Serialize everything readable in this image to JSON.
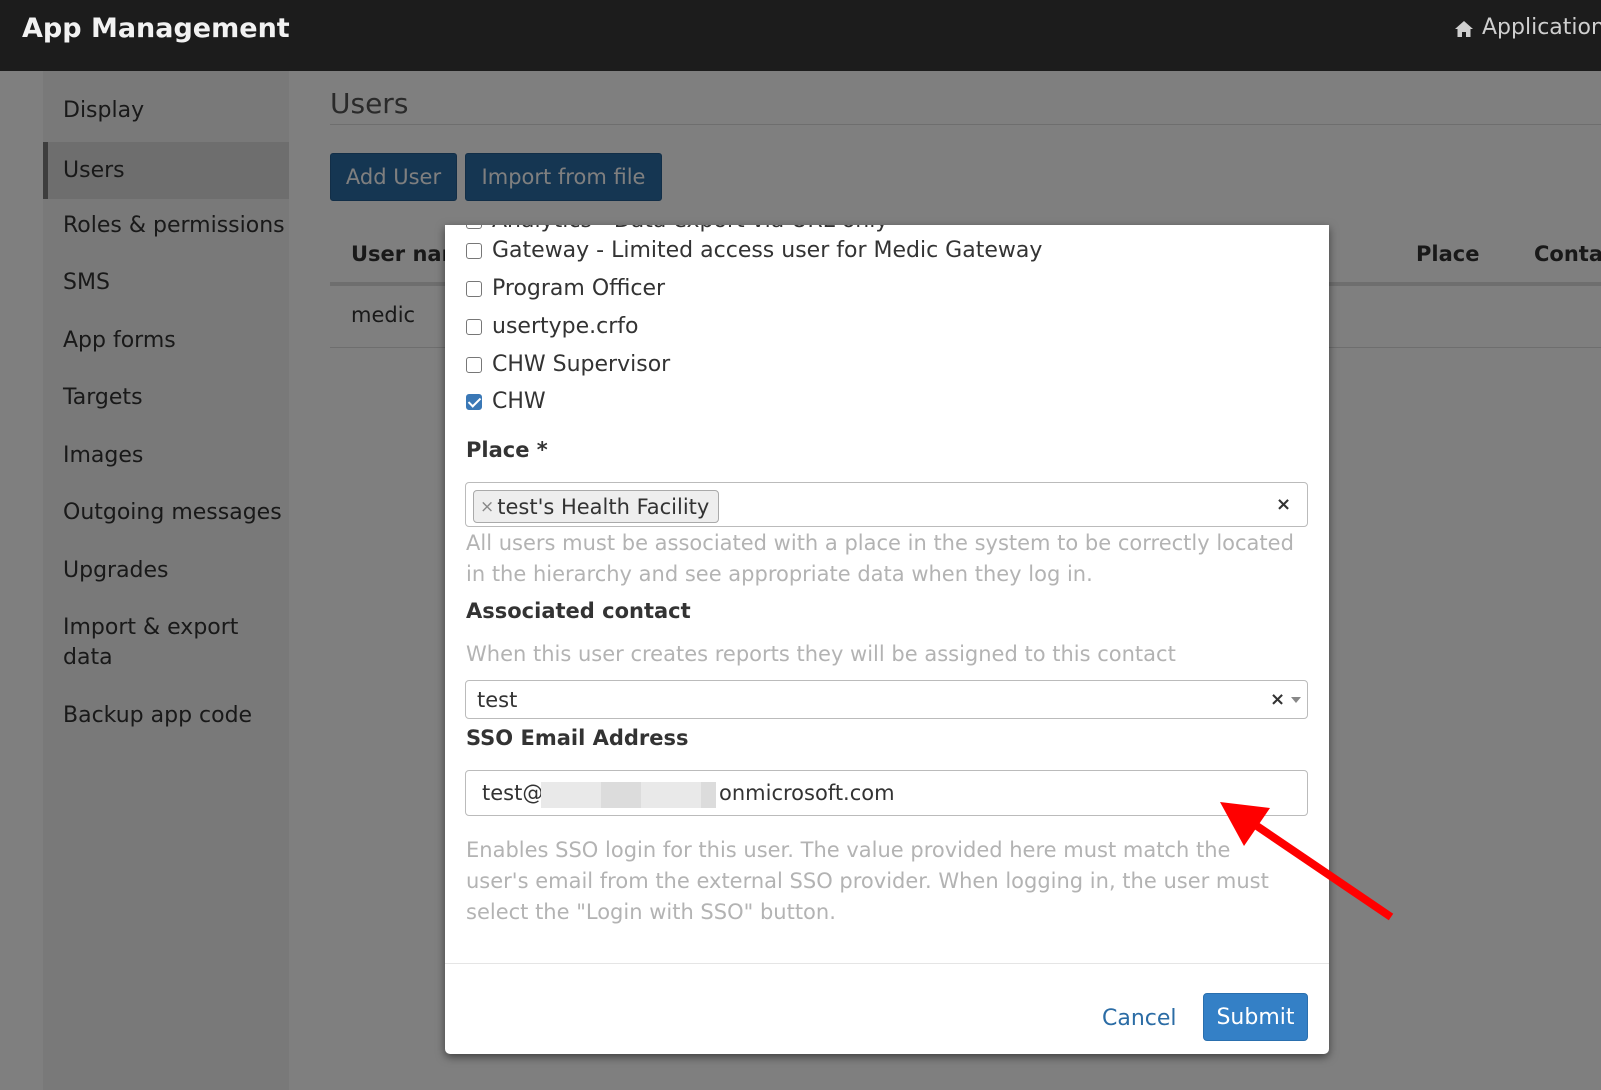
{
  "header": {
    "title": "App Management",
    "application_link": "Application",
    "home_icon": "home-icon"
  },
  "sidebar": {
    "items": [
      {
        "label": "Display"
      },
      {
        "label": "Users",
        "active": true
      },
      {
        "label": "Roles & permissions"
      },
      {
        "label": "SMS"
      },
      {
        "label": "App forms"
      },
      {
        "label": "Targets"
      },
      {
        "label": "Images"
      },
      {
        "label": "Outgoing messages"
      },
      {
        "label": "Upgrades"
      },
      {
        "label": "Import & export data"
      },
      {
        "label": "Backup app code"
      }
    ]
  },
  "main": {
    "title": "Users",
    "add_user": "Add User",
    "import_file": "Import from file",
    "columns": [
      "User nam",
      "Place",
      "Conta"
    ],
    "rows": [
      {
        "username": "medic"
      }
    ]
  },
  "modal": {
    "roles": [
      {
        "label": "Analytics - Data export via URL only",
        "checked": false
      },
      {
        "label": "Gateway - Limited access user for Medic Gateway",
        "checked": false
      },
      {
        "label": "Program Officer",
        "checked": false
      },
      {
        "label": "usertype.crfo",
        "checked": false
      },
      {
        "label": "CHW Supervisor",
        "checked": false
      },
      {
        "label": "CHW",
        "checked": true
      }
    ],
    "place": {
      "label": "Place *",
      "selected": "test's Health Facility",
      "help": "All users must be associated with a place in the system to be correctly located in the hierarchy and see appropriate data when they log in."
    },
    "contact": {
      "label": "Associated contact",
      "help": "When this user creates reports they will be assigned to this contact",
      "value": "test"
    },
    "sso": {
      "label": "SSO Email Address",
      "value_prefix": "test@",
      "value_suffix": "onmicrosoft.com",
      "help": "Enables SSO login for this user. The value provided here must match the user's email from the external SSO provider. When logging in, the user must select the \"Login with SSO\" button."
    },
    "cancel": "Cancel",
    "submit": "Submit"
  },
  "colors": {
    "header_bg": "#1c1c1c",
    "primary": "#2b6ca5",
    "submit": "#3480c6",
    "arrow": "#ff0000"
  }
}
